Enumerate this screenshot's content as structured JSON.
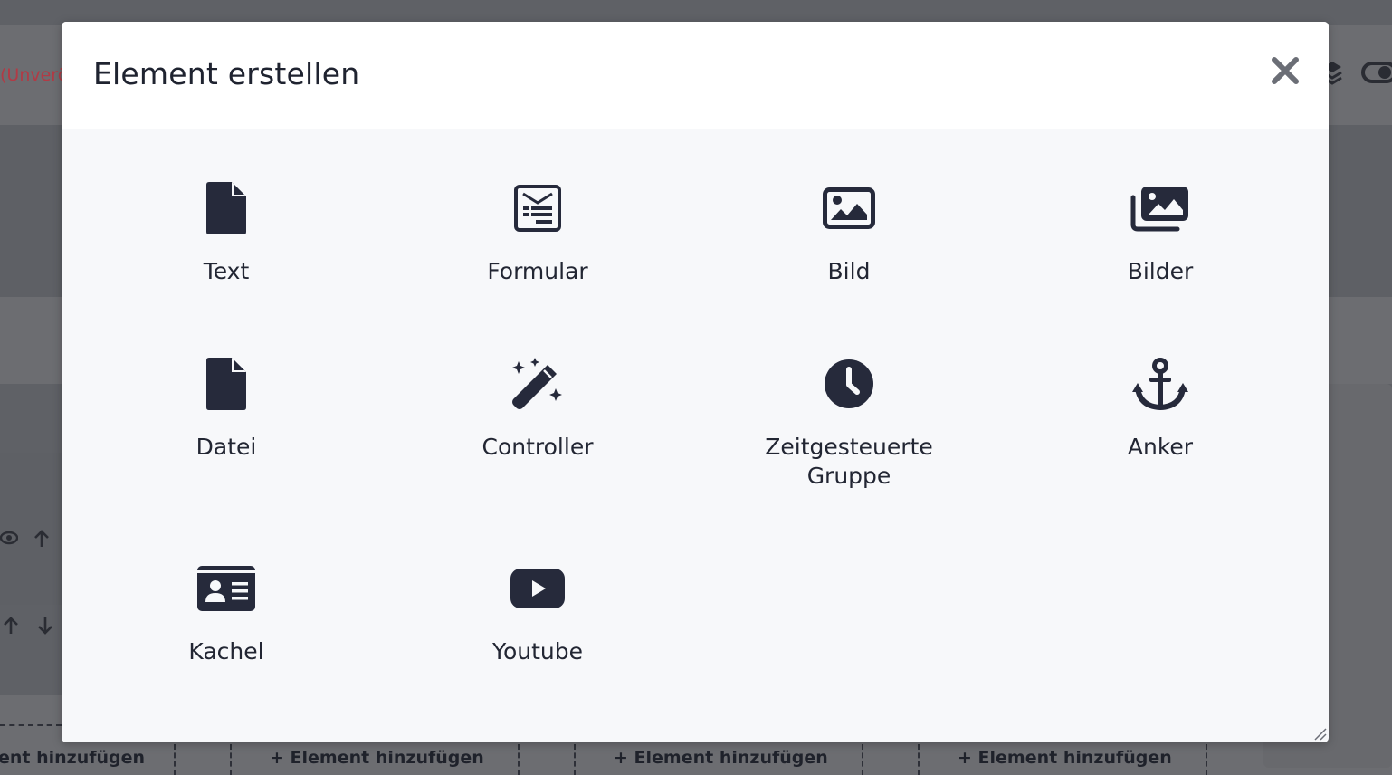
{
  "background": {
    "status_text": "(Unverö",
    "add_element_labels": [
      "ent hinzufügen",
      "+ Element hinzufügen",
      "+ Element hinzufügen",
      "+ Element hinzufügen"
    ]
  },
  "modal": {
    "title": "Element erstellen",
    "close_icon": "close-icon",
    "items": [
      {
        "label": "Text",
        "icon": "file-icon"
      },
      {
        "label": "Formular",
        "icon": "form-icon"
      },
      {
        "label": "Bild",
        "icon": "image-icon"
      },
      {
        "label": "Bilder",
        "icon": "images-icon"
      },
      {
        "label": "Datei",
        "icon": "file-icon"
      },
      {
        "label": "Controller",
        "icon": "magic-wand-icon"
      },
      {
        "label": "Zeitgesteuerte Gruppe",
        "icon": "clock-icon"
      },
      {
        "label": "Anker",
        "icon": "anchor-icon"
      },
      {
        "label": "Kachel",
        "icon": "id-card-icon"
      },
      {
        "label": "Youtube",
        "icon": "youtube-icon"
      }
    ]
  },
  "colors": {
    "icon": "#262a3b",
    "text": "#222633",
    "overlay": "#5f6166",
    "modal_body": "#f7f8fa",
    "status_red": "#b23a45"
  }
}
